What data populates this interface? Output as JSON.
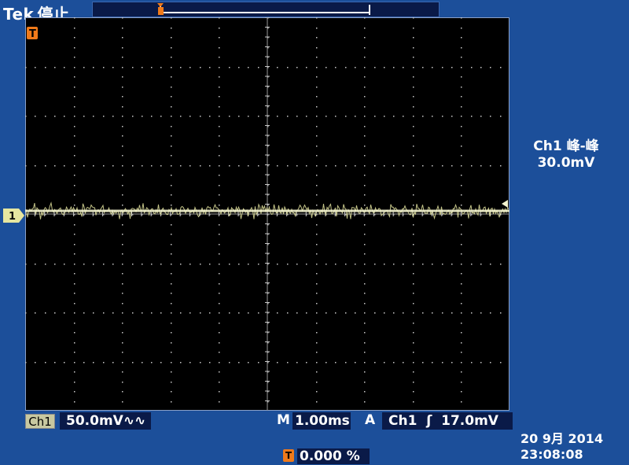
{
  "header": {
    "brand": "Tek",
    "status": "停止"
  },
  "markers": {
    "trigger_glyph": "T",
    "ch1_glyph": "1"
  },
  "readouts": {
    "ch1_tag": "Ch1",
    "ch1_scale": "50.0mV∿∿",
    "time_label": "M",
    "time_scale": "1.00ms",
    "trigger_label": "A",
    "trigger_setting": "Ch1  ʃ  17.0mV",
    "position_value": "0.000 %"
  },
  "measurement": {
    "label": "Ch1 峰-峰",
    "value": "30.0mV"
  },
  "datetime": {
    "date": "20 9月  2014",
    "time": "23:08:08"
  },
  "colors": {
    "background": "#1c4f9a",
    "screen": "#000000",
    "trace": "#e6e6a0",
    "trigger_accent": "#f07a1a"
  }
}
